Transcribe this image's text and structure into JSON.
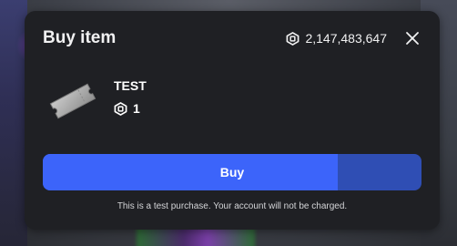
{
  "modal": {
    "title": "Buy item",
    "balance": "2,147,483,647",
    "balance_icon": "robux-icon",
    "close_icon": "close-icon"
  },
  "item": {
    "name": "TEST",
    "price": "1",
    "price_icon": "robux-icon",
    "thumbnail_icon": "ticket-item-icon"
  },
  "buy_button": {
    "label": "Buy",
    "hold_progress": 0.778,
    "color_fill": "#3c64fa",
    "color_track": "#2f4eb4"
  },
  "footnote": "This is a test purchase. Your account will not be charged.",
  "colors": {
    "modal_background": "#1f2024",
    "text": "#ffffff"
  }
}
